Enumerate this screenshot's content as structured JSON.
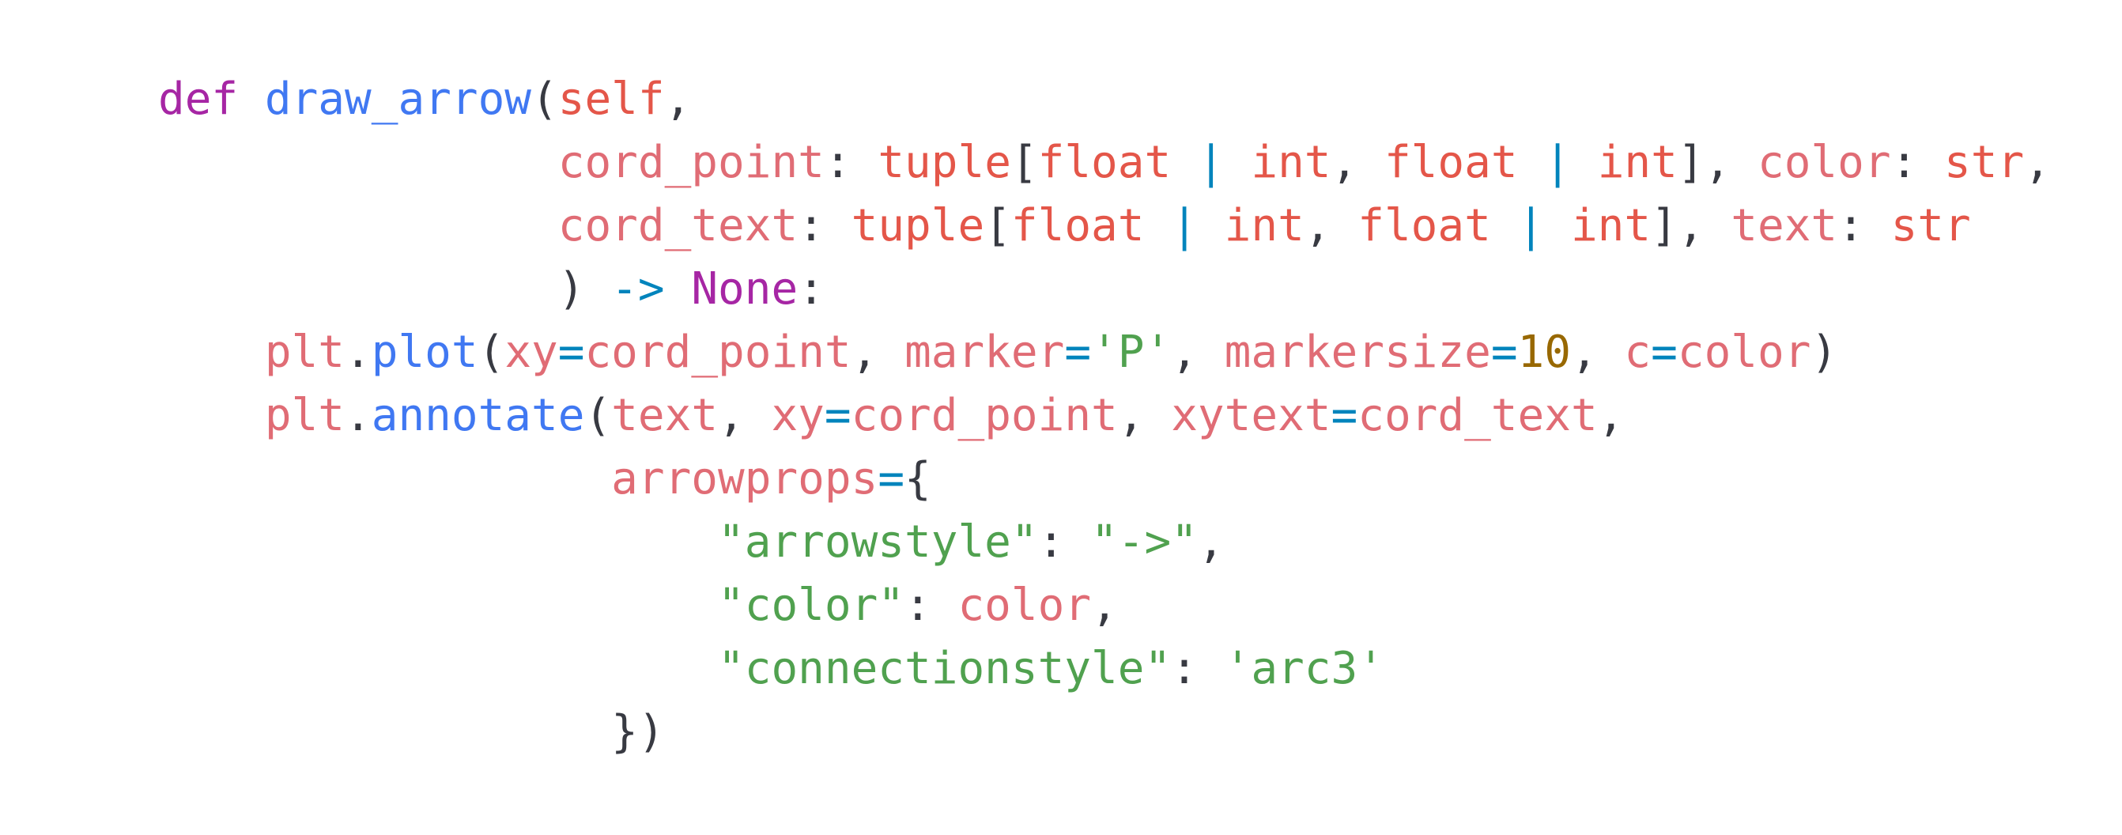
{
  "colors": {
    "background": "#ffffff",
    "keyword": "#a626a4",
    "function": "#4078f2",
    "variable": "#e06c75",
    "type": "#e45649",
    "operator": "#0184bc",
    "string": "#50a14f",
    "number": "#986801",
    "punctuation": "#383a42"
  },
  "code": {
    "lines": [
      [
        {
          "t": "def",
          "c": "keyword"
        },
        {
          "t": " ",
          "c": "punctuation"
        },
        {
          "t": "draw_arrow",
          "c": "function"
        },
        {
          "t": "(",
          "c": "punctuation"
        },
        {
          "t": "self",
          "c": "type"
        },
        {
          "t": ",",
          "c": "punctuation"
        }
      ],
      [
        {
          "t": "               ",
          "c": "punctuation"
        },
        {
          "t": "cord_point",
          "c": "variable"
        },
        {
          "t": ": ",
          "c": "punctuation"
        },
        {
          "t": "tuple",
          "c": "type"
        },
        {
          "t": "[",
          "c": "punctuation"
        },
        {
          "t": "float",
          "c": "type"
        },
        {
          "t": " | ",
          "c": "operator"
        },
        {
          "t": "int",
          "c": "type"
        },
        {
          "t": ", ",
          "c": "punctuation"
        },
        {
          "t": "float",
          "c": "type"
        },
        {
          "t": " | ",
          "c": "operator"
        },
        {
          "t": "int",
          "c": "type"
        },
        {
          "t": "], ",
          "c": "punctuation"
        },
        {
          "t": "color",
          "c": "variable"
        },
        {
          "t": ": ",
          "c": "punctuation"
        },
        {
          "t": "str",
          "c": "type"
        },
        {
          "t": ",",
          "c": "punctuation"
        }
      ],
      [
        {
          "t": "               ",
          "c": "punctuation"
        },
        {
          "t": "cord_text",
          "c": "variable"
        },
        {
          "t": ": ",
          "c": "punctuation"
        },
        {
          "t": "tuple",
          "c": "type"
        },
        {
          "t": "[",
          "c": "punctuation"
        },
        {
          "t": "float",
          "c": "type"
        },
        {
          "t": " | ",
          "c": "operator"
        },
        {
          "t": "int",
          "c": "type"
        },
        {
          "t": ", ",
          "c": "punctuation"
        },
        {
          "t": "float",
          "c": "type"
        },
        {
          "t": " | ",
          "c": "operator"
        },
        {
          "t": "int",
          "c": "type"
        },
        {
          "t": "], ",
          "c": "punctuation"
        },
        {
          "t": "text",
          "c": "variable"
        },
        {
          "t": ": ",
          "c": "punctuation"
        },
        {
          "t": "str",
          "c": "type"
        }
      ],
      [
        {
          "t": "               ",
          "c": "punctuation"
        },
        {
          "t": ") ",
          "c": "punctuation"
        },
        {
          "t": "->",
          "c": "operator"
        },
        {
          "t": " ",
          "c": "punctuation"
        },
        {
          "t": "None",
          "c": "keyword"
        },
        {
          "t": ":",
          "c": "punctuation"
        }
      ],
      [
        {
          "t": "    ",
          "c": "punctuation"
        },
        {
          "t": "plt",
          "c": "variable"
        },
        {
          "t": ".",
          "c": "punctuation"
        },
        {
          "t": "plot",
          "c": "function"
        },
        {
          "t": "(",
          "c": "punctuation"
        },
        {
          "t": "xy",
          "c": "variable"
        },
        {
          "t": "=",
          "c": "operator"
        },
        {
          "t": "cord_point",
          "c": "variable"
        },
        {
          "t": ", ",
          "c": "punctuation"
        },
        {
          "t": "marker",
          "c": "variable"
        },
        {
          "t": "=",
          "c": "operator"
        },
        {
          "t": "'P'",
          "c": "string"
        },
        {
          "t": ", ",
          "c": "punctuation"
        },
        {
          "t": "markersize",
          "c": "variable"
        },
        {
          "t": "=",
          "c": "operator"
        },
        {
          "t": "10",
          "c": "number"
        },
        {
          "t": ", ",
          "c": "punctuation"
        },
        {
          "t": "c",
          "c": "variable"
        },
        {
          "t": "=",
          "c": "operator"
        },
        {
          "t": "color",
          "c": "variable"
        },
        {
          "t": ")",
          "c": "punctuation"
        }
      ],
      [
        {
          "t": "    ",
          "c": "punctuation"
        },
        {
          "t": "plt",
          "c": "variable"
        },
        {
          "t": ".",
          "c": "punctuation"
        },
        {
          "t": "annotate",
          "c": "function"
        },
        {
          "t": "(",
          "c": "punctuation"
        },
        {
          "t": "text",
          "c": "variable"
        },
        {
          "t": ", ",
          "c": "punctuation"
        },
        {
          "t": "xy",
          "c": "variable"
        },
        {
          "t": "=",
          "c": "operator"
        },
        {
          "t": "cord_point",
          "c": "variable"
        },
        {
          "t": ", ",
          "c": "punctuation"
        },
        {
          "t": "xytext",
          "c": "variable"
        },
        {
          "t": "=",
          "c": "operator"
        },
        {
          "t": "cord_text",
          "c": "variable"
        },
        {
          "t": ",",
          "c": "punctuation"
        }
      ],
      [
        {
          "t": "                 ",
          "c": "punctuation"
        },
        {
          "t": "arrowprops",
          "c": "variable"
        },
        {
          "t": "=",
          "c": "operator"
        },
        {
          "t": "{",
          "c": "punctuation"
        }
      ],
      [
        {
          "t": "                     ",
          "c": "punctuation"
        },
        {
          "t": "\"arrowstyle\"",
          "c": "string"
        },
        {
          "t": ": ",
          "c": "punctuation"
        },
        {
          "t": "\"->\"",
          "c": "string"
        },
        {
          "t": ",",
          "c": "punctuation"
        }
      ],
      [
        {
          "t": "                     ",
          "c": "punctuation"
        },
        {
          "t": "\"color\"",
          "c": "string"
        },
        {
          "t": ": ",
          "c": "punctuation"
        },
        {
          "t": "color",
          "c": "variable"
        },
        {
          "t": ",",
          "c": "punctuation"
        }
      ],
      [
        {
          "t": "                     ",
          "c": "punctuation"
        },
        {
          "t": "\"connectionstyle\"",
          "c": "string"
        },
        {
          "t": ": ",
          "c": "punctuation"
        },
        {
          "t": "'arc3'",
          "c": "string"
        }
      ],
      [
        {
          "t": "                 ",
          "c": "punctuation"
        },
        {
          "t": "})",
          "c": "punctuation"
        }
      ]
    ]
  }
}
